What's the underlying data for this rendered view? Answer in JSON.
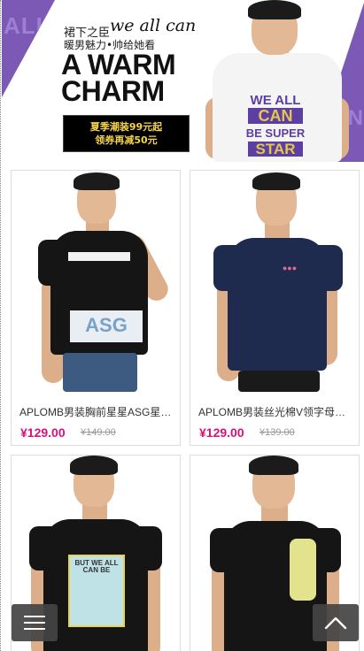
{
  "banner": {
    "cn_line1": "裙下之臣",
    "we_all_can": "we all can",
    "cn_line2": "暖男魅力•帅给她看",
    "headline_line1": "A WARM",
    "headline_line2": "CHARM",
    "promo_line1": "夏季潮装99元起",
    "promo_line2": "领券再减50元",
    "side_text_left": "ALL",
    "side_text_right": "CAN",
    "shirt_print": [
      "WE ALL",
      "CAN",
      "BE SUPER",
      "STAR"
    ],
    "accent_color": "#7b59b4"
  },
  "products": [
    {
      "title": "APLOMB男装胸前星星ASG星星印花短袖T恤",
      "price": "¥129.00",
      "old_price": "¥149.00",
      "shirt_color": "#151515",
      "print": "ASG"
    },
    {
      "title": "APLOMB男装丝光棉V领字母印花短袖T恤",
      "price": "¥129.00",
      "old_price": "¥139.00",
      "shirt_color": "#1f2a4f",
      "print": ""
    },
    {
      "title": "",
      "price": "",
      "old_price": "",
      "shirt_color": "#151515",
      "print": "BUT WE ALL CAN BE"
    },
    {
      "title": "",
      "price": "",
      "old_price": "",
      "shirt_color": "#151515",
      "print": ""
    }
  ],
  "controls": {
    "menu_icon": "hamburger-menu-icon",
    "top_icon": "chevron-up-icon"
  }
}
